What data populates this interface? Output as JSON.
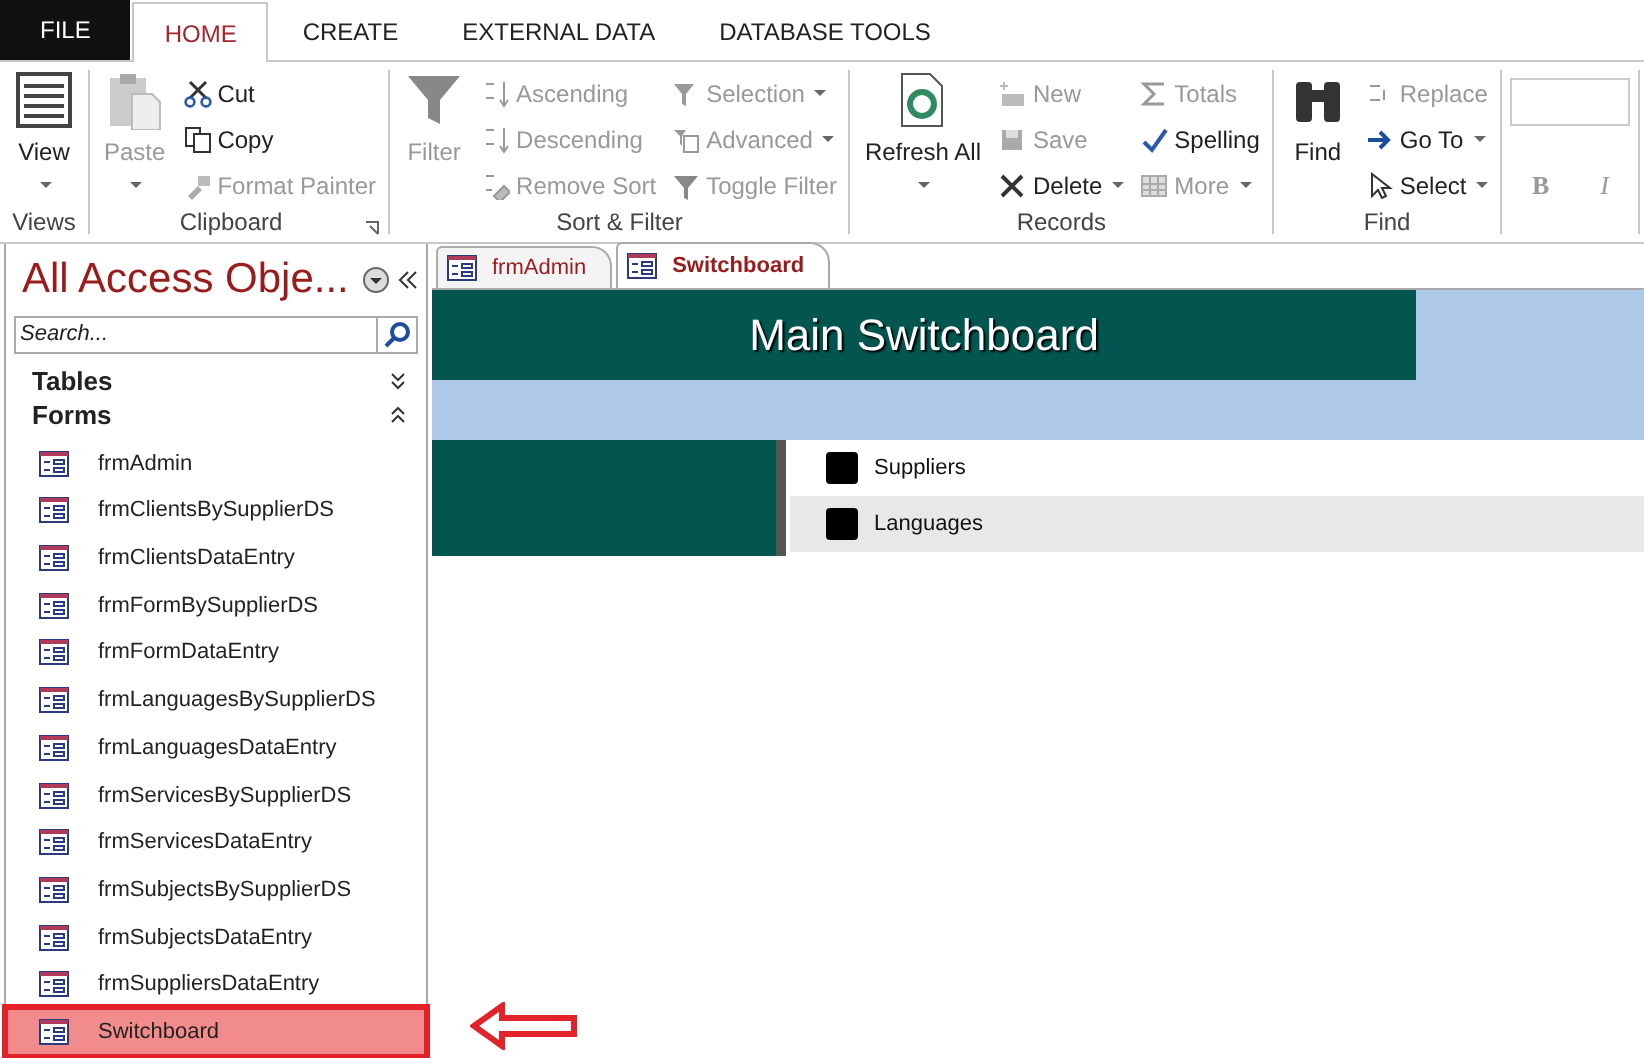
{
  "ribbon_tabs": [
    {
      "label": "FILE",
      "kind": "file",
      "selected": false
    },
    {
      "label": "HOME",
      "kind": "tab",
      "selected": true
    },
    {
      "label": "CREATE",
      "kind": "tab",
      "selected": false
    },
    {
      "label": "EXTERNAL DATA",
      "kind": "tab",
      "selected": false
    },
    {
      "label": "DATABASE TOOLS",
      "kind": "tab",
      "selected": false
    }
  ],
  "ribbon_groups": [
    {
      "label": "Views",
      "launcher": false,
      "items": [
        {
          "label": "View",
          "kind": "large",
          "disabled": false,
          "dropdown": true
        }
      ]
    },
    {
      "label": "Clipboard",
      "launcher": true,
      "items": [
        {
          "label": "Paste",
          "kind": "large",
          "disabled": true,
          "dropdown": true
        },
        {
          "label": "Cut",
          "kind": "small",
          "disabled": false,
          "dropdown": false
        },
        {
          "label": "Copy",
          "kind": "small",
          "disabled": false,
          "dropdown": false
        },
        {
          "label": "Format Painter",
          "kind": "small",
          "disabled": true,
          "dropdown": false
        }
      ]
    },
    {
      "label": "Sort & Filter",
      "launcher": false,
      "items": [
        {
          "label": "Filter",
          "kind": "large",
          "disabled": true,
          "dropdown": false
        },
        {
          "label": "Ascending",
          "kind": "small",
          "disabled": true,
          "dropdown": false
        },
        {
          "label": "Descending",
          "kind": "small",
          "disabled": true,
          "dropdown": false
        },
        {
          "label": "Remove Sort",
          "kind": "small",
          "disabled": true,
          "dropdown": false
        },
        {
          "label": "Selection",
          "kind": "small",
          "disabled": true,
          "dropdown": true
        },
        {
          "label": "Advanced",
          "kind": "small",
          "disabled": true,
          "dropdown": true
        },
        {
          "label": "Toggle Filter",
          "kind": "small",
          "disabled": true,
          "dropdown": false
        }
      ]
    },
    {
      "label": "Records",
      "launcher": false,
      "items": [
        {
          "label": "Refresh All",
          "kind": "large",
          "disabled": false,
          "dropdown": true
        },
        {
          "label": "New",
          "kind": "small",
          "disabled": true,
          "dropdown": false
        },
        {
          "label": "Save",
          "kind": "small",
          "disabled": true,
          "dropdown": false
        },
        {
          "label": "Delete",
          "kind": "small",
          "disabled": false,
          "dropdown": true
        },
        {
          "label": "Totals",
          "kind": "small",
          "disabled": true,
          "dropdown": false
        },
        {
          "label": "Spelling",
          "kind": "small",
          "disabled": false,
          "dropdown": false
        },
        {
          "label": "More",
          "kind": "small",
          "disabled": true,
          "dropdown": true
        }
      ]
    },
    {
      "label": "Find",
      "launcher": false,
      "items": [
        {
          "label": "Find",
          "kind": "large",
          "disabled": false,
          "dropdown": false
        },
        {
          "label": "Replace",
          "kind": "small",
          "disabled": true,
          "dropdown": false
        },
        {
          "label": "Go To",
          "kind": "small",
          "disabled": false,
          "dropdown": true
        },
        {
          "label": "Select",
          "kind": "small",
          "disabled": false,
          "dropdown": true
        }
      ]
    },
    {
      "items": [
        {
          "kind": "field"
        },
        {
          "label": "B",
          "kind": "format",
          "disabled": true
        },
        {
          "label": "I",
          "kind": "format",
          "disabled": true
        }
      ]
    }
  ],
  "nav_pane": {
    "title": "All Access Obje...",
    "search": {
      "placeholder": "Search..."
    },
    "sections": [
      {
        "label": "Tables",
        "expanded": false
      },
      {
        "label": "Forms",
        "expanded": true,
        "items": [
          {
            "label": "frmAdmin",
            "selected": false
          },
          {
            "label": "frmClientsBySupplierDS",
            "selected": false
          },
          {
            "label": "frmClientsDataEntry",
            "selected": false
          },
          {
            "label": "frmFormBySupplierDS",
            "selected": false
          },
          {
            "label": "frmFormDataEntry",
            "selected": false
          },
          {
            "label": "frmLanguagesBySupplierDS",
            "selected": false
          },
          {
            "label": "frmLanguagesDataEntry",
            "selected": false
          },
          {
            "label": "frmServicesBySupplierDS",
            "selected": false
          },
          {
            "label": "frmServicesDataEntry",
            "selected": false
          },
          {
            "label": "frmSubjectsBySupplierDS",
            "selected": false
          },
          {
            "label": "frmSubjectsDataEntry",
            "selected": false
          },
          {
            "label": "frmSuppliersDataEntry",
            "selected": false
          },
          {
            "label": "Switchboard",
            "selected": true
          }
        ]
      }
    ]
  },
  "document_tabs": [
    {
      "label": "frmAdmin",
      "selected": false
    },
    {
      "label": "Switchboard",
      "selected": true
    }
  ],
  "switchboard": {
    "title": "Main Switchboard",
    "buttons": [
      {
        "label": "Suppliers",
        "selected": false
      },
      {
        "label": "Languages",
        "selected": true
      }
    ]
  }
}
